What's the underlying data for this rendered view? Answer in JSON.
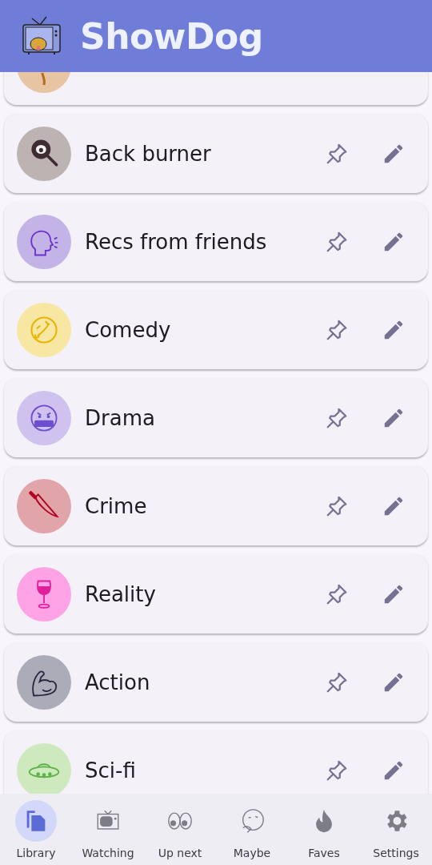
{
  "app_bar": {
    "title": "ShowDog"
  },
  "categories": [
    {
      "kind": "baked",
      "color": "#e6c4a4"
    },
    {
      "name": "Back burner",
      "kind": "pan",
      "color": "#bdb3b3"
    },
    {
      "name": "Recs from friends",
      "kind": "head",
      "color": "#c4b3e6"
    },
    {
      "name": "Comedy",
      "kind": "laugh",
      "color": "#f8e7a3"
    },
    {
      "name": "Drama",
      "kind": "cursing",
      "color": "#cfc2ef"
    },
    {
      "name": "Crime",
      "kind": "knife",
      "color": "#e1a4a9"
    },
    {
      "name": "Reality",
      "kind": "wine",
      "color": "#fda3e6"
    },
    {
      "name": "Action",
      "kind": "muscle",
      "color": "#acacb8"
    },
    {
      "name": "Sci-fi",
      "kind": "ufo",
      "color": "#cde9bd"
    }
  ],
  "nav": [
    {
      "label": "Library",
      "kind": "library",
      "selected": true
    },
    {
      "label": "Watching",
      "kind": "tv",
      "selected": false
    },
    {
      "label": "Up next",
      "kind": "eyes",
      "selected": false
    },
    {
      "label": "Maybe",
      "kind": "thinking",
      "selected": false
    },
    {
      "label": "Faves",
      "kind": "fire",
      "selected": false
    },
    {
      "label": "Settings",
      "kind": "gear",
      "selected": false
    }
  ]
}
